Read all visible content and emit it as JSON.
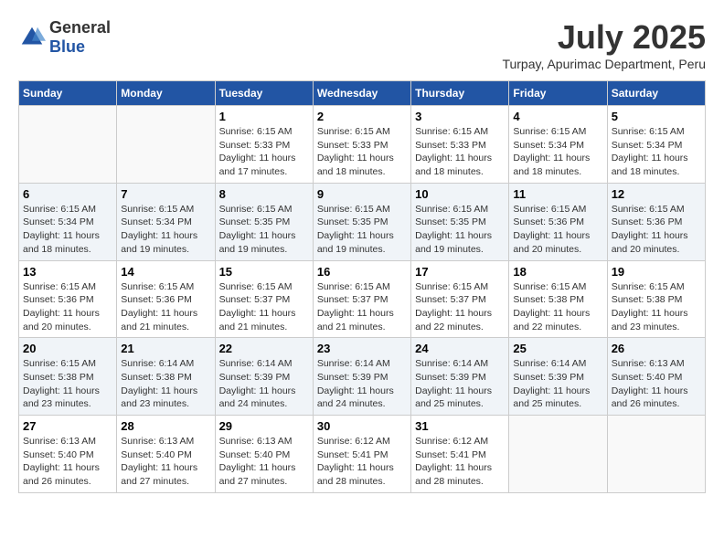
{
  "header": {
    "logo": {
      "general": "General",
      "blue": "Blue"
    },
    "title": "July 2025",
    "location": "Turpay, Apurimac Department, Peru"
  },
  "days_of_week": [
    "Sunday",
    "Monday",
    "Tuesday",
    "Wednesday",
    "Thursday",
    "Friday",
    "Saturday"
  ],
  "weeks": [
    [
      {
        "day": "",
        "info": ""
      },
      {
        "day": "",
        "info": ""
      },
      {
        "day": "1",
        "info": "Sunrise: 6:15 AM\nSunset: 5:33 PM\nDaylight: 11 hours and 17 minutes."
      },
      {
        "day": "2",
        "info": "Sunrise: 6:15 AM\nSunset: 5:33 PM\nDaylight: 11 hours and 18 minutes."
      },
      {
        "day": "3",
        "info": "Sunrise: 6:15 AM\nSunset: 5:33 PM\nDaylight: 11 hours and 18 minutes."
      },
      {
        "day": "4",
        "info": "Sunrise: 6:15 AM\nSunset: 5:34 PM\nDaylight: 11 hours and 18 minutes."
      },
      {
        "day": "5",
        "info": "Sunrise: 6:15 AM\nSunset: 5:34 PM\nDaylight: 11 hours and 18 minutes."
      }
    ],
    [
      {
        "day": "6",
        "info": "Sunrise: 6:15 AM\nSunset: 5:34 PM\nDaylight: 11 hours and 18 minutes."
      },
      {
        "day": "7",
        "info": "Sunrise: 6:15 AM\nSunset: 5:34 PM\nDaylight: 11 hours and 19 minutes."
      },
      {
        "day": "8",
        "info": "Sunrise: 6:15 AM\nSunset: 5:35 PM\nDaylight: 11 hours and 19 minutes."
      },
      {
        "day": "9",
        "info": "Sunrise: 6:15 AM\nSunset: 5:35 PM\nDaylight: 11 hours and 19 minutes."
      },
      {
        "day": "10",
        "info": "Sunrise: 6:15 AM\nSunset: 5:35 PM\nDaylight: 11 hours and 19 minutes."
      },
      {
        "day": "11",
        "info": "Sunrise: 6:15 AM\nSunset: 5:36 PM\nDaylight: 11 hours and 20 minutes."
      },
      {
        "day": "12",
        "info": "Sunrise: 6:15 AM\nSunset: 5:36 PM\nDaylight: 11 hours and 20 minutes."
      }
    ],
    [
      {
        "day": "13",
        "info": "Sunrise: 6:15 AM\nSunset: 5:36 PM\nDaylight: 11 hours and 20 minutes."
      },
      {
        "day": "14",
        "info": "Sunrise: 6:15 AM\nSunset: 5:36 PM\nDaylight: 11 hours and 21 minutes."
      },
      {
        "day": "15",
        "info": "Sunrise: 6:15 AM\nSunset: 5:37 PM\nDaylight: 11 hours and 21 minutes."
      },
      {
        "day": "16",
        "info": "Sunrise: 6:15 AM\nSunset: 5:37 PM\nDaylight: 11 hours and 21 minutes."
      },
      {
        "day": "17",
        "info": "Sunrise: 6:15 AM\nSunset: 5:37 PM\nDaylight: 11 hours and 22 minutes."
      },
      {
        "day": "18",
        "info": "Sunrise: 6:15 AM\nSunset: 5:38 PM\nDaylight: 11 hours and 22 minutes."
      },
      {
        "day": "19",
        "info": "Sunrise: 6:15 AM\nSunset: 5:38 PM\nDaylight: 11 hours and 23 minutes."
      }
    ],
    [
      {
        "day": "20",
        "info": "Sunrise: 6:15 AM\nSunset: 5:38 PM\nDaylight: 11 hours and 23 minutes."
      },
      {
        "day": "21",
        "info": "Sunrise: 6:14 AM\nSunset: 5:38 PM\nDaylight: 11 hours and 23 minutes."
      },
      {
        "day": "22",
        "info": "Sunrise: 6:14 AM\nSunset: 5:39 PM\nDaylight: 11 hours and 24 minutes."
      },
      {
        "day": "23",
        "info": "Sunrise: 6:14 AM\nSunset: 5:39 PM\nDaylight: 11 hours and 24 minutes."
      },
      {
        "day": "24",
        "info": "Sunrise: 6:14 AM\nSunset: 5:39 PM\nDaylight: 11 hours and 25 minutes."
      },
      {
        "day": "25",
        "info": "Sunrise: 6:14 AM\nSunset: 5:39 PM\nDaylight: 11 hours and 25 minutes."
      },
      {
        "day": "26",
        "info": "Sunrise: 6:13 AM\nSunset: 5:40 PM\nDaylight: 11 hours and 26 minutes."
      }
    ],
    [
      {
        "day": "27",
        "info": "Sunrise: 6:13 AM\nSunset: 5:40 PM\nDaylight: 11 hours and 26 minutes."
      },
      {
        "day": "28",
        "info": "Sunrise: 6:13 AM\nSunset: 5:40 PM\nDaylight: 11 hours and 27 minutes."
      },
      {
        "day": "29",
        "info": "Sunrise: 6:13 AM\nSunset: 5:40 PM\nDaylight: 11 hours and 27 minutes."
      },
      {
        "day": "30",
        "info": "Sunrise: 6:12 AM\nSunset: 5:41 PM\nDaylight: 11 hours and 28 minutes."
      },
      {
        "day": "31",
        "info": "Sunrise: 6:12 AM\nSunset: 5:41 PM\nDaylight: 11 hours and 28 minutes."
      },
      {
        "day": "",
        "info": ""
      },
      {
        "day": "",
        "info": ""
      }
    ]
  ]
}
